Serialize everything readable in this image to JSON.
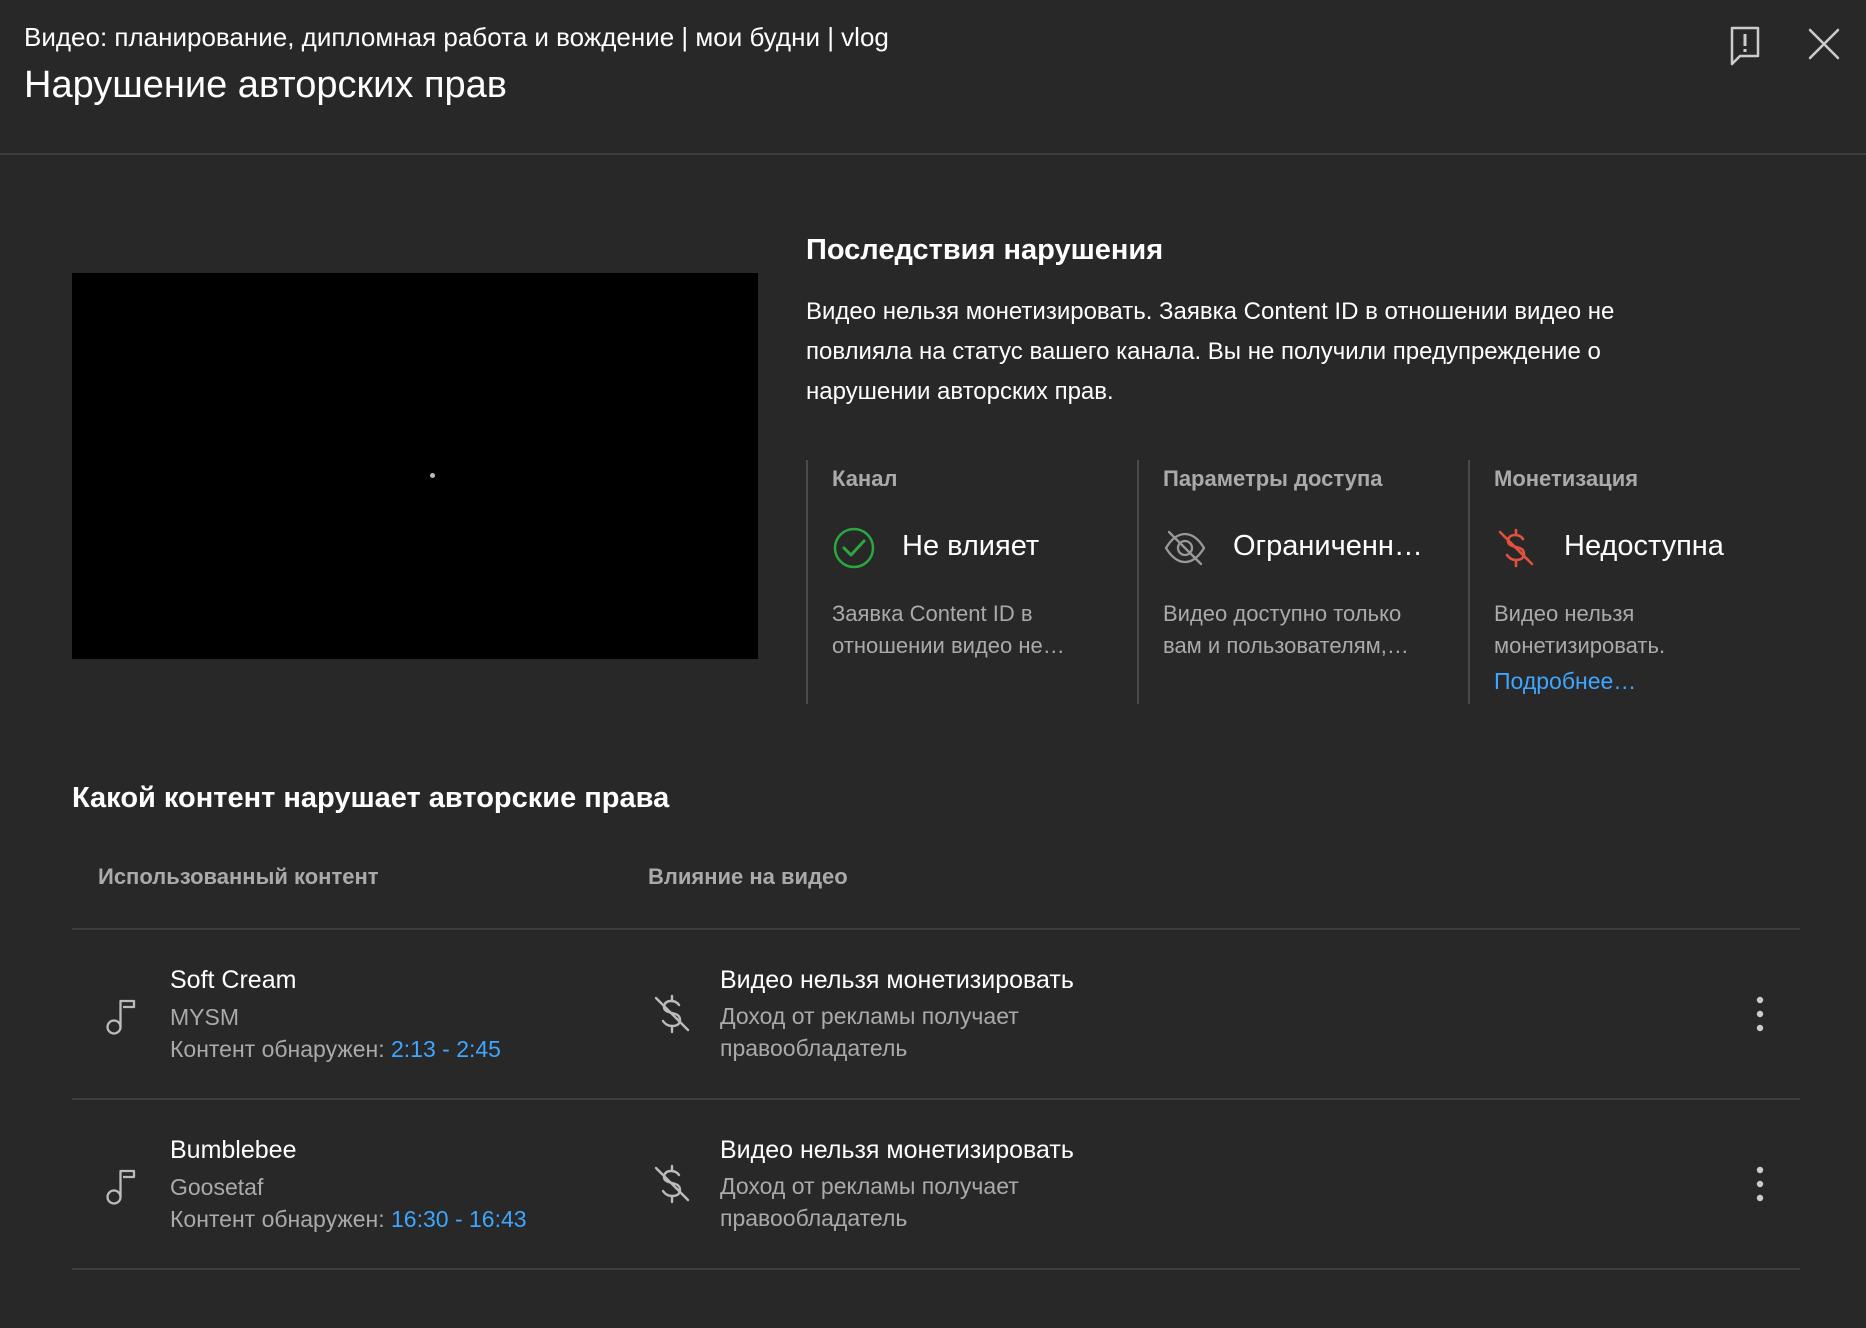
{
  "header": {
    "video_line": "Видео: планирование, дипломная работа и вождение | мои будни | vlog",
    "title": "Нарушение авторских прав"
  },
  "consequences": {
    "title": "Последствия нарушения",
    "text": "Видео нельзя монетизировать. Заявка Content ID в отношении видео не повлияла на статус вашего канала. Вы не получили предупреждение о нарушении авторских прав."
  },
  "cards": [
    {
      "label": "Канал",
      "status": "Не влияет",
      "icon": "check-circle-icon",
      "desc_lines": [
        "Заявка Content ID в",
        "отношении видео не…"
      ]
    },
    {
      "label": "Параметры доступа",
      "status": "Ограниченн…",
      "icon": "eye-off-icon",
      "desc_lines": [
        "Видео доступно только",
        "вам и пользователям,…"
      ]
    },
    {
      "label": "Монетизация",
      "status": "Недоступна",
      "icon": "no-money-icon",
      "desc_lines": [
        "Видео нельзя",
        "монетизировать."
      ],
      "link": "Подробнее…"
    }
  ],
  "content": {
    "title": "Какой контент нарушает авторские права",
    "col_used": "Использованный контент",
    "col_impact": "Влияние на видео",
    "rows": [
      {
        "name": "Soft Cream",
        "artist": "MYSM",
        "detected_label": "Контент обнаружен: ",
        "time": "2:13 - 2:45",
        "impact_title": "Видео нельзя монетизировать",
        "impact_desc": "Доход от рекламы получает правообладатель"
      },
      {
        "name": "Bumblebee",
        "artist": "Goosetaf",
        "detected_label": "Контент обнаружен: ",
        "time": "16:30 - 16:43",
        "impact_title": "Видео нельзя монетизировать",
        "impact_desc": "Доход от рекламы получает правообладатель"
      }
    ]
  },
  "colors": {
    "background": "#282828",
    "link": "#3ea6ff",
    "ok_green": "#2ba640",
    "warn_red": "#e1523d",
    "muted": "#aaaaaa"
  }
}
